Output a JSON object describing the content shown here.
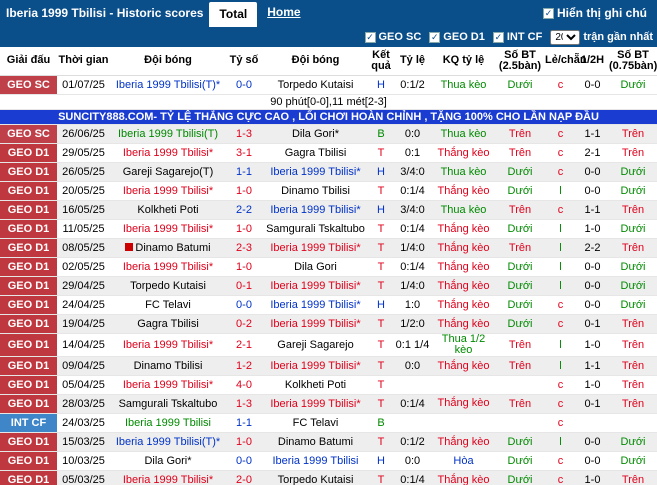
{
  "header": {
    "title": "Iberia 1999 Tbilisi - Historic scores",
    "tab_total": "Total",
    "tab_home": "Home",
    "show_notes": "Hiển thị ghi chú"
  },
  "filters": {
    "geo_sc": "GEO SC",
    "geo_d1": "GEO D1",
    "int_cf": "INT CF",
    "recent_count": "20",
    "recent_label": "trận gần nhất"
  },
  "columns": [
    "Giải đấu",
    "Thời gian",
    "Đội bóng",
    "Tỷ số",
    "Đội bóng",
    "Kết quả",
    "Tỷ lệ",
    "KQ tỷ lệ",
    "Số BT (2.5bàn)",
    "Lẻ/chẵn",
    "1/2H",
    "Số BT (0.75bàn)"
  ],
  "note_row": "90 phút[0-0],11 mét[2-3]",
  "banner": "SUNCITY888.COM- TỶ LỆ THẮNG CỰC CAO , LỐI CHƠI HOÀN CHỈNH , TẶNG 100% CHO LẦN NẠP ĐẦU",
  "rows": [
    {
      "league": "GEO SC",
      "lc": "geo-sc",
      "date": "01/07/25",
      "home": "Iberia 1999 Tbilisi(T)*",
      "hc": "blue",
      "score": "0-0",
      "sc": "blue",
      "away": "Torpedo Kutaisi",
      "ac": "",
      "res": "H",
      "rc": "blue",
      "odds": "0:1/2",
      "kq": "Thua kèo",
      "kc": "green",
      "ou": "Dưới",
      "oc": "green",
      "oe": "c",
      "ec": "red",
      "half": "0-0",
      "ou2": "Dưới",
      "o2c": "green"
    },
    {
      "league": "GEO SC",
      "lc": "geo-sc",
      "date": "26/06/25",
      "home": "Iberia 1999 Tbilisi(T)",
      "hc": "green",
      "score": "1-3",
      "sc": "red",
      "away": "Dila Gori*",
      "ac": "",
      "res": "B",
      "rc": "green",
      "odds": "0:0",
      "kq": "Thua kèo",
      "kc": "green",
      "ou": "Trên",
      "oc": "red",
      "oe": "c",
      "ec": "red",
      "half": "1-1",
      "ou2": "Trên",
      "o2c": "red"
    },
    {
      "league": "GEO D1",
      "lc": "geo-d1",
      "date": "29/05/25",
      "home": "Iberia 1999 Tbilisi*",
      "hc": "red",
      "score": "3-1",
      "sc": "red",
      "away": "Gagra Tbilisi",
      "ac": "",
      "res": "T",
      "rc": "red",
      "odds": "0:1",
      "kq": "Thắng kèo",
      "kc": "red",
      "ou": "Trên",
      "oc": "red",
      "oe": "c",
      "ec": "red",
      "half": "2-1",
      "ou2": "Trên",
      "o2c": "red"
    },
    {
      "league": "GEO D1",
      "lc": "geo-d1",
      "date": "26/05/25",
      "home": "Gareji Sagarejo(T)",
      "hc": "",
      "score": "1-1",
      "sc": "blue",
      "away": "Iberia 1999 Tbilisi*",
      "ac": "blue",
      "res": "H",
      "rc": "blue",
      "odds": "3/4:0",
      "kq": "Thua kèo",
      "kc": "green",
      "ou": "Dưới",
      "oc": "green",
      "oe": "c",
      "ec": "red",
      "half": "0-0",
      "ou2": "Dưới",
      "o2c": "green"
    },
    {
      "league": "GEO D1",
      "lc": "geo-d1",
      "date": "20/05/25",
      "home": "Iberia 1999 Tbilisi*",
      "hc": "red",
      "score": "1-0",
      "sc": "red",
      "away": "Dinamo Tbilisi",
      "ac": "",
      "res": "T",
      "rc": "red",
      "odds": "0:1/4",
      "kq": "Thắng kèo",
      "kc": "red",
      "ou": "Dưới",
      "oc": "green",
      "oe": "l",
      "ec": "green",
      "half": "0-0",
      "ou2": "Dưới",
      "o2c": "green"
    },
    {
      "league": "GEO D1",
      "lc": "geo-d1",
      "date": "16/05/25",
      "home": "Kolkheti Poti",
      "hc": "",
      "score": "2-2",
      "sc": "blue",
      "away": "Iberia 1999 Tbilisi*",
      "ac": "blue",
      "res": "H",
      "rc": "blue",
      "odds": "3/4:0",
      "kq": "Thua kèo",
      "kc": "green",
      "ou": "Trên",
      "oc": "red",
      "oe": "c",
      "ec": "red",
      "half": "1-1",
      "ou2": "Trên",
      "o2c": "red"
    },
    {
      "league": "GEO D1",
      "lc": "geo-d1",
      "date": "11/05/25",
      "home": "Iberia 1999 Tbilisi*",
      "hc": "red",
      "score": "1-0",
      "sc": "red",
      "away": "Samgurali Tskaltubo",
      "ac": "",
      "res": "T",
      "rc": "red",
      "odds": "0:1/4",
      "kq": "Thắng kèo",
      "kc": "red",
      "ou": "Dưới",
      "oc": "green",
      "oe": "l",
      "ec": "green",
      "half": "1-0",
      "ou2": "Dưới",
      "o2c": "green"
    },
    {
      "league": "GEO D1",
      "lc": "geo-d1",
      "date": "08/05/25",
      "home": "Dinamo Batumi",
      "hc": "",
      "flag": true,
      "score": "2-3",
      "sc": "red",
      "away": "Iberia 1999 Tbilisi*",
      "ac": "red",
      "res": "T",
      "rc": "red",
      "odds": "1/4:0",
      "kq": "Thắng kèo",
      "kc": "red",
      "ou": "Trên",
      "oc": "red",
      "oe": "l",
      "ec": "green",
      "half": "2-2",
      "ou2": "Trên",
      "o2c": "red"
    },
    {
      "league": "GEO D1",
      "lc": "geo-d1",
      "date": "02/05/25",
      "home": "Iberia 1999 Tbilisi*",
      "hc": "red",
      "score": "1-0",
      "sc": "red",
      "away": "Dila Gori",
      "ac": "",
      "res": "T",
      "rc": "red",
      "odds": "0:1/4",
      "kq": "Thắng kèo",
      "kc": "red",
      "ou": "Dưới",
      "oc": "green",
      "oe": "l",
      "ec": "green",
      "half": "0-0",
      "ou2": "Dưới",
      "o2c": "green"
    },
    {
      "league": "GEO D1",
      "lc": "geo-d1",
      "date": "29/04/25",
      "home": "Torpedo Kutaisi",
      "hc": "",
      "score": "0-1",
      "sc": "red",
      "away": "Iberia 1999 Tbilisi*",
      "ac": "red",
      "res": "T",
      "rc": "red",
      "odds": "1/4:0",
      "kq": "Thắng kèo",
      "kc": "red",
      "ou": "Dưới",
      "oc": "green",
      "oe": "l",
      "ec": "green",
      "half": "0-0",
      "ou2": "Dưới",
      "o2c": "green"
    },
    {
      "league": "GEO D1",
      "lc": "geo-d1",
      "date": "24/04/25",
      "home": "FC Telavi",
      "hc": "",
      "score": "0-0",
      "sc": "blue",
      "away": "Iberia 1999 Tbilisi*",
      "ac": "blue",
      "res": "H",
      "rc": "blue",
      "odds": "1:0",
      "kq": "Thắng kèo",
      "kc": "red",
      "ou": "Dưới",
      "oc": "green",
      "oe": "c",
      "ec": "red",
      "half": "0-0",
      "ou2": "Dưới",
      "o2c": "green"
    },
    {
      "league": "GEO D1",
      "lc": "geo-d1",
      "date": "19/04/25",
      "home": "Gagra Tbilisi",
      "hc": "",
      "score": "0-2",
      "sc": "red",
      "away": "Iberia 1999 Tbilisi*",
      "ac": "red",
      "res": "T",
      "rc": "red",
      "odds": "1/2:0",
      "kq": "Thắng kèo",
      "kc": "red",
      "ou": "Dưới",
      "oc": "green",
      "oe": "c",
      "ec": "red",
      "half": "0-1",
      "ou2": "Trên",
      "o2c": "red"
    },
    {
      "league": "GEO D1",
      "lc": "geo-d1",
      "date": "14/04/25",
      "home": "Iberia 1999 Tbilisi*",
      "hc": "red",
      "score": "2-1",
      "sc": "red",
      "away": "Gareji Sagarejo",
      "ac": "",
      "res": "T",
      "rc": "red",
      "odds": "0:1 1/4",
      "kq": "Thua 1/2 kèo",
      "kc": "green",
      "ou": "Trên",
      "oc": "red",
      "oe": "l",
      "ec": "green",
      "half": "1-0",
      "ou2": "Trên",
      "o2c": "red",
      "tall": true
    },
    {
      "league": "GEO D1",
      "lc": "geo-d1",
      "date": "09/04/25",
      "home": "Dinamo Tbilisi",
      "hc": "",
      "score": "1-2",
      "sc": "red",
      "away": "Iberia 1999 Tbilisi*",
      "ac": "red",
      "res": "T",
      "rc": "red",
      "odds": "0:0",
      "kq": "Thắng kèo",
      "kc": "red",
      "ou": "Trên",
      "oc": "red",
      "oe": "l",
      "ec": "green",
      "half": "1-1",
      "ou2": "Trên",
      "o2c": "red"
    },
    {
      "league": "GEO D1",
      "lc": "geo-d1",
      "date": "05/04/25",
      "home": "Iberia 1999 Tbilisi*",
      "hc": "red",
      "score": "4-0",
      "sc": "red",
      "away": "Kolkheti Poti",
      "ac": "",
      "res": "T",
      "rc": "red",
      "odds": "",
      "kq": "",
      "kc": "",
      "ou": "",
      "oc": "",
      "oe": "c",
      "ec": "red",
      "half": "1-0",
      "ou2": "Trên",
      "o2c": "red"
    },
    {
      "league": "GEO D1",
      "lc": "geo-d1",
      "date": "28/03/25",
      "home": "Samgurali Tskaltubo",
      "hc": "",
      "score": "1-3",
      "sc": "red",
      "away": "Iberia 1999 Tbilisi*",
      "ac": "red",
      "res": "T",
      "rc": "red",
      "odds": "0:1/4",
      "kq": "Thắng kèo",
      "kc": "red",
      "ou": "Trên",
      "oc": "red",
      "oe": "c",
      "ec": "red",
      "half": "0-1",
      "ou2": "Trên",
      "o2c": "red",
      "tall": true
    },
    {
      "league": "INT CF",
      "lc": "int-cf",
      "date": "24/03/25",
      "home": "Iberia 1999 Tbilisi",
      "hc": "green",
      "score": "1-1",
      "sc": "blue",
      "away": "FC Telavi",
      "ac": "",
      "res": "B",
      "rc": "green",
      "odds": "",
      "kq": "",
      "kc": "",
      "ou": "",
      "oc": "",
      "oe": "c",
      "ec": "red",
      "half": "",
      "ou2": "",
      "o2c": ""
    },
    {
      "league": "GEO D1",
      "lc": "geo-d1",
      "date": "15/03/25",
      "home": "Iberia 1999 Tbilisi(T)*",
      "hc": "blue",
      "score": "1-0",
      "sc": "red",
      "away": "Dinamo Batumi",
      "ac": "",
      "res": "T",
      "rc": "red",
      "odds": "0:1/2",
      "kq": "Thắng kèo",
      "kc": "red",
      "ou": "Dưới",
      "oc": "green",
      "oe": "l",
      "ec": "green",
      "half": "0-0",
      "ou2": "Dưới",
      "o2c": "green"
    },
    {
      "league": "GEO D1",
      "lc": "geo-d1",
      "date": "10/03/25",
      "home": "Dila Gori*",
      "hc": "",
      "score": "0-0",
      "sc": "blue",
      "away": "Iberia 1999 Tbilisi",
      "ac": "blue",
      "res": "H",
      "rc": "blue",
      "odds": "0:0",
      "kq": "Hòa",
      "kc": "blue",
      "ou": "Dưới",
      "oc": "green",
      "oe": "c",
      "ec": "red",
      "half": "0-0",
      "ou2": "Dưới",
      "o2c": "green"
    },
    {
      "league": "GEO D1",
      "lc": "geo-d1",
      "date": "05/03/25",
      "home": "Iberia 1999 Tbilisi*",
      "hc": "red",
      "score": "2-0",
      "sc": "red",
      "away": "Torpedo Kutaisi",
      "ac": "",
      "res": "T",
      "rc": "red",
      "odds": "0:1/4",
      "kq": "Thắng kèo",
      "kc": "red",
      "ou": "Dưới",
      "oc": "green",
      "oe": "c",
      "ec": "red",
      "half": "1-0",
      "ou2": "Trên",
      "o2c": "red"
    }
  ]
}
